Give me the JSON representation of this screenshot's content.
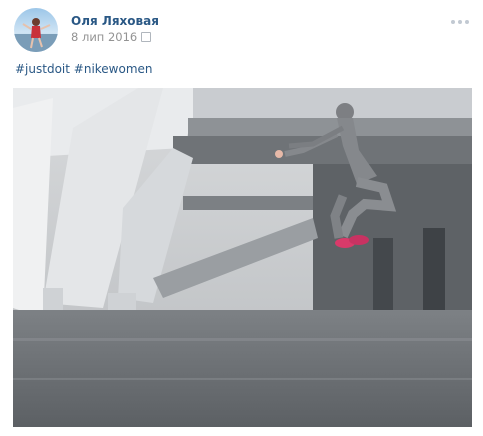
{
  "post": {
    "author_name": "Оля Ляховая",
    "date": "8 лип 2016",
    "hashtags": [
      "#justdoit",
      "#nikewomen"
    ],
    "photo_description_icon": "photo"
  },
  "icons": {
    "more": "more-dots-icon",
    "date": "calendar-icon"
  },
  "colors": {
    "link": "#2a5885",
    "muted": "#939393"
  }
}
